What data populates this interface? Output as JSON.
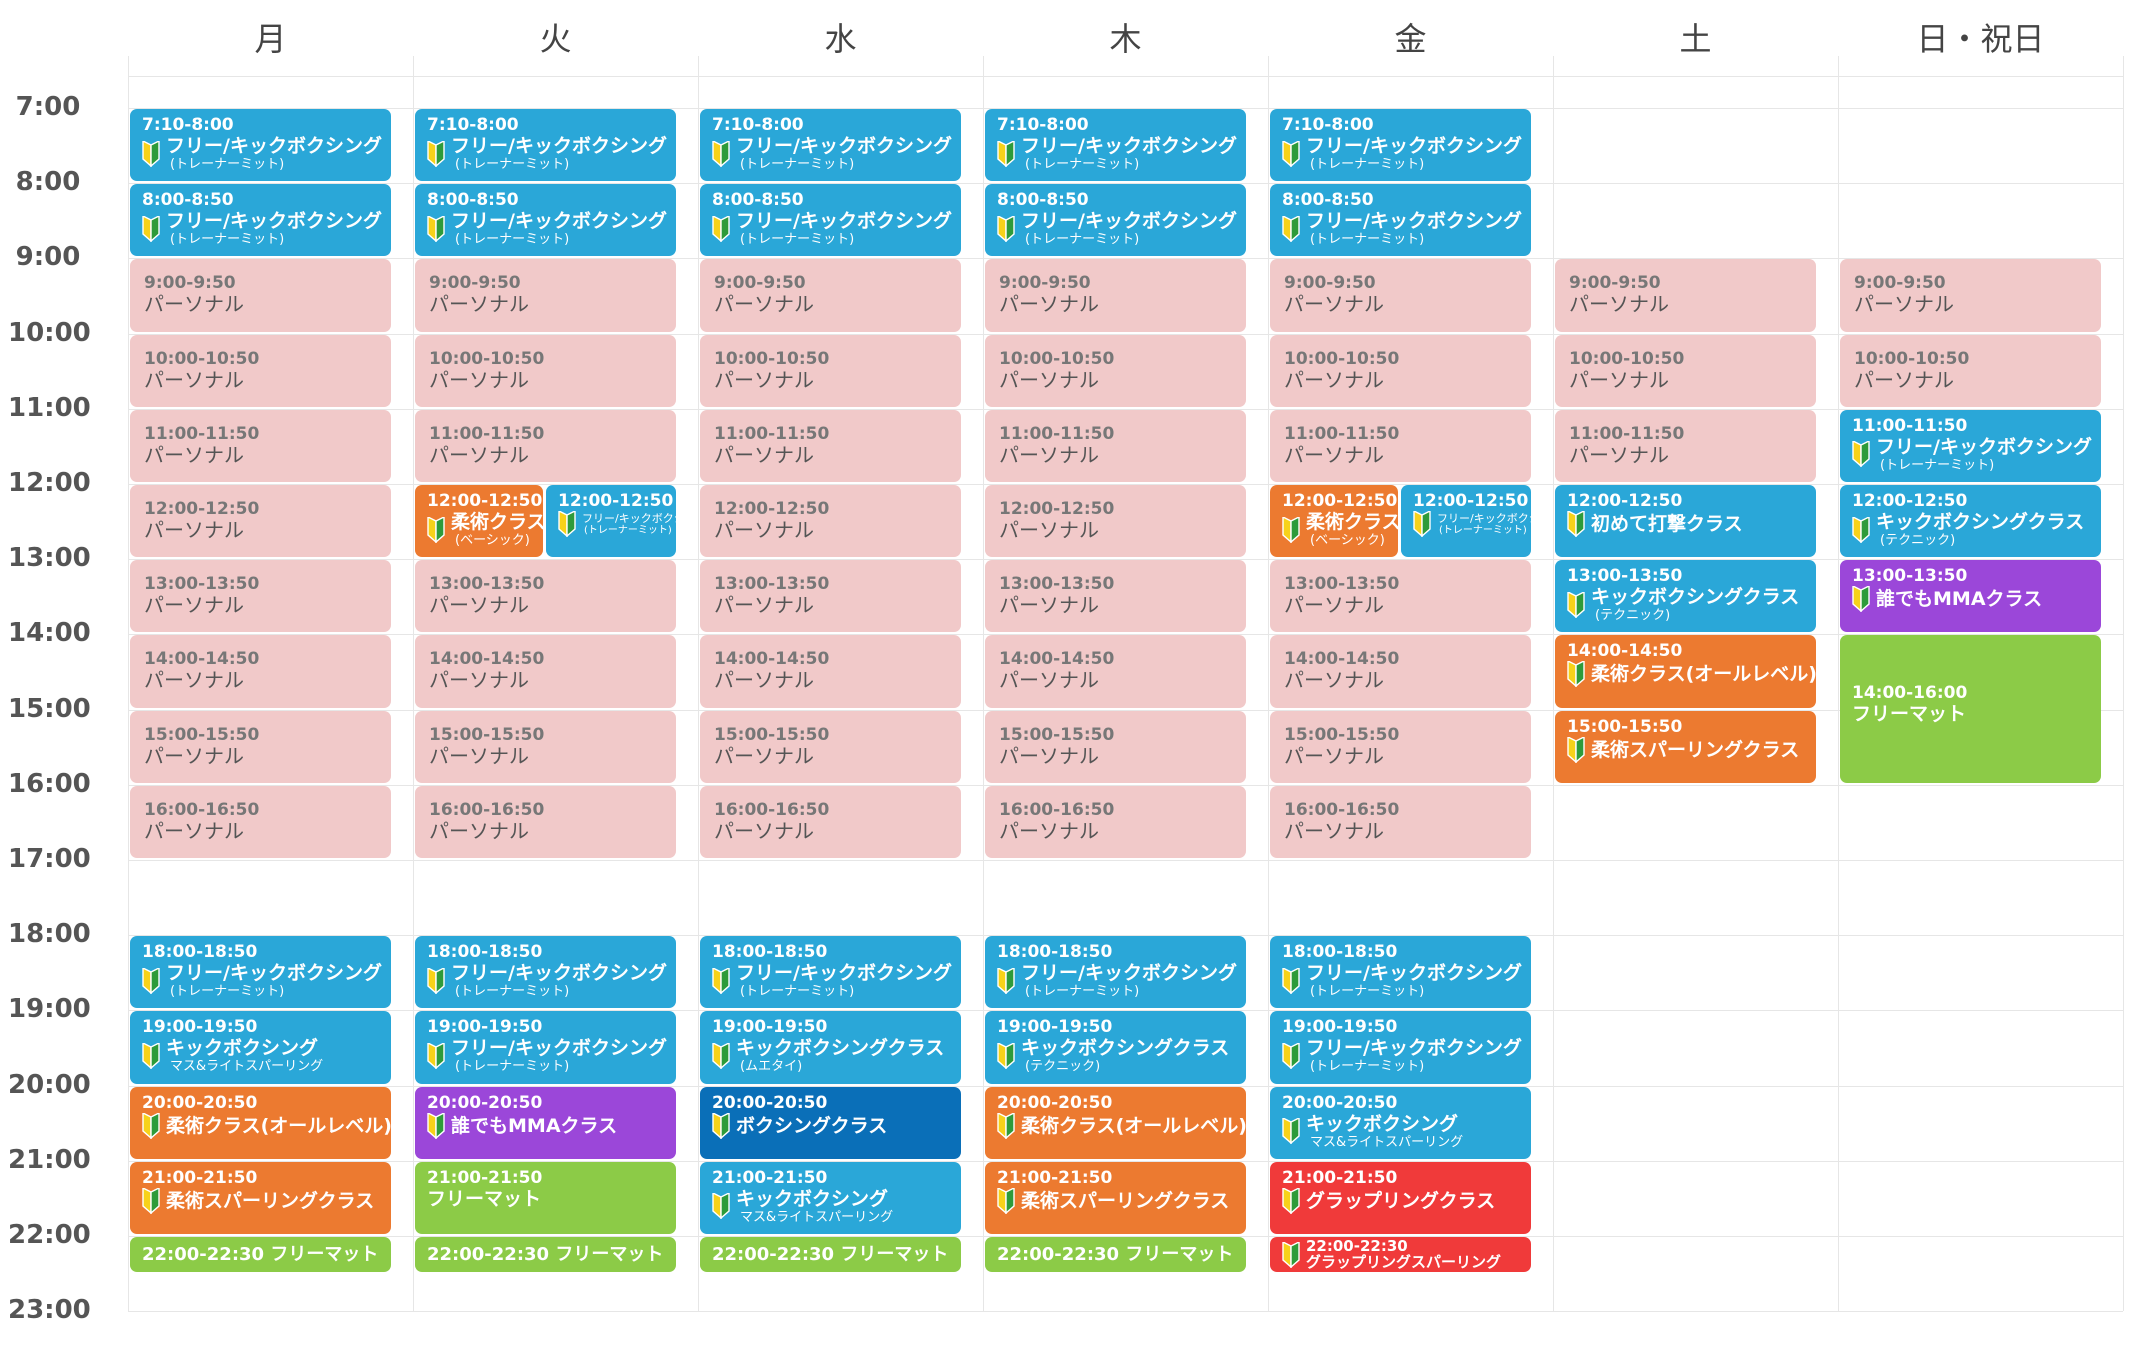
{
  "colors": {
    "personal": "#f1c9c9",
    "kick": "#2aa7d8",
    "jiu": "#ec7a30",
    "mma": "#9b47d9",
    "free": "#8ccb47",
    "boxing": "#0a6fb8",
    "grappling": "#f03a3a"
  },
  "days": [
    "月",
    "火",
    "水",
    "木",
    "金",
    "土",
    "日・祝日"
  ],
  "hours": [
    "7:00",
    "8:00",
    "9:00",
    "10:00",
    "11:00",
    "12:00",
    "13:00",
    "14:00",
    "15:00",
    "16:00",
    "17:00",
    "18:00",
    "19:00",
    "20:00",
    "21:00",
    "22:00",
    "23:00"
  ],
  "events": [
    {
      "d": 0,
      "s": 7.0,
      "e": 8.0,
      "c": "kick",
      "time": "7:10-8:00",
      "title": "フリー/キックボクシング",
      "sub": "(トレーナーミット)",
      "icon": "beginner-icon"
    },
    {
      "d": 0,
      "s": 8.0,
      "e": 9.0,
      "c": "kick",
      "time": "8:00-8:50",
      "title": "フリー/キックボクシング",
      "sub": "(トレーナーミット)",
      "icon": "beginner-icon"
    },
    {
      "d": 0,
      "s": 9.0,
      "e": 10.0,
      "c": "personal",
      "time": "9:00-9:50",
      "title": "パーソナル"
    },
    {
      "d": 0,
      "s": 10.0,
      "e": 11.0,
      "c": "personal",
      "time": "10:00-10:50",
      "title": "パーソナル"
    },
    {
      "d": 0,
      "s": 11.0,
      "e": 12.0,
      "c": "personal",
      "time": "11:00-11:50",
      "title": "パーソナル"
    },
    {
      "d": 0,
      "s": 12.0,
      "e": 13.0,
      "c": "personal",
      "time": "12:00-12:50",
      "title": "パーソナル"
    },
    {
      "d": 0,
      "s": 13.0,
      "e": 14.0,
      "c": "personal",
      "time": "13:00-13:50",
      "title": "パーソナル"
    },
    {
      "d": 0,
      "s": 14.0,
      "e": 15.0,
      "c": "personal",
      "time": "14:00-14:50",
      "title": "パーソナル"
    },
    {
      "d": 0,
      "s": 15.0,
      "e": 16.0,
      "c": "personal",
      "time": "15:00-15:50",
      "title": "パーソナル"
    },
    {
      "d": 0,
      "s": 16.0,
      "e": 17.0,
      "c": "personal",
      "time": "16:00-16:50",
      "title": "パーソナル"
    },
    {
      "d": 0,
      "s": 18.0,
      "e": 19.0,
      "c": "kick",
      "time": "18:00-18:50",
      "title": "フリー/キックボクシング",
      "sub": "(トレーナーミット)",
      "icon": "beginner-icon"
    },
    {
      "d": 0,
      "s": 19.0,
      "e": 20.0,
      "c": "kick",
      "time": "19:00-19:50",
      "title": "キックボクシング",
      "sub": "マス&ライトスパーリング",
      "icon": "beginner-icon"
    },
    {
      "d": 0,
      "s": 20.0,
      "e": 21.0,
      "c": "jiu",
      "time": "20:00-20:50",
      "title": "柔術クラス(オールレベル)",
      "icon": "beginner-icon"
    },
    {
      "d": 0,
      "s": 21.0,
      "e": 22.0,
      "c": "jiu",
      "time": "21:00-21:50",
      "title": "柔術スパーリングクラス",
      "icon": "beginner-icon"
    },
    {
      "d": 0,
      "s": 22.0,
      "e": 22.5,
      "c": "free",
      "inline": "22:00-22:30 フリーマット"
    },
    {
      "d": 1,
      "s": 7.0,
      "e": 8.0,
      "c": "kick",
      "time": "7:10-8:00",
      "title": "フリー/キックボクシング",
      "sub": "(トレーナーミット)",
      "icon": "beginner-icon"
    },
    {
      "d": 1,
      "s": 8.0,
      "e": 9.0,
      "c": "kick",
      "time": "8:00-8:50",
      "title": "フリー/キックボクシング",
      "sub": "(トレーナーミット)",
      "icon": "beginner-icon"
    },
    {
      "d": 1,
      "s": 9.0,
      "e": 10.0,
      "c": "personal",
      "time": "9:00-9:50",
      "title": "パーソナル"
    },
    {
      "d": 1,
      "s": 10.0,
      "e": 11.0,
      "c": "personal",
      "time": "10:00-10:50",
      "title": "パーソナル"
    },
    {
      "d": 1,
      "s": 11.0,
      "e": 12.0,
      "c": "personal",
      "time": "11:00-11:50",
      "title": "パーソナル"
    },
    {
      "d": 1,
      "s": 12.0,
      "e": 13.0,
      "c": "jiu",
      "half": 0,
      "time": "12:00-12:50",
      "title": "柔術クラス",
      "sub": "(ベーシック)",
      "icon": "beginner-icon"
    },
    {
      "d": 1,
      "s": 12.0,
      "e": 13.0,
      "c": "kick",
      "half": 1,
      "time": "12:00-12:50",
      "title": "フリー/キックボクシング",
      "sub": "(トレーナーミット)",
      "icon": "beginner-icon",
      "small": true
    },
    {
      "d": 1,
      "s": 13.0,
      "e": 14.0,
      "c": "personal",
      "time": "13:00-13:50",
      "title": "パーソナル"
    },
    {
      "d": 1,
      "s": 14.0,
      "e": 15.0,
      "c": "personal",
      "time": "14:00-14:50",
      "title": "パーソナル"
    },
    {
      "d": 1,
      "s": 15.0,
      "e": 16.0,
      "c": "personal",
      "time": "15:00-15:50",
      "title": "パーソナル"
    },
    {
      "d": 1,
      "s": 16.0,
      "e": 17.0,
      "c": "personal",
      "time": "16:00-16:50",
      "title": "パーソナル"
    },
    {
      "d": 1,
      "s": 18.0,
      "e": 19.0,
      "c": "kick",
      "time": "18:00-18:50",
      "title": "フリー/キックボクシング",
      "sub": "(トレーナーミット)",
      "icon": "beginner-icon"
    },
    {
      "d": 1,
      "s": 19.0,
      "e": 20.0,
      "c": "kick",
      "time": "19:00-19:50",
      "title": "フリー/キックボクシング",
      "sub": "(トレーナーミット)",
      "icon": "beginner-icon"
    },
    {
      "d": 1,
      "s": 20.0,
      "e": 21.0,
      "c": "mma",
      "time": "20:00-20:50",
      "title": "誰でもMMAクラス",
      "icon": "beginner-icon"
    },
    {
      "d": 1,
      "s": 21.0,
      "e": 22.0,
      "c": "free",
      "time": "21:00-21:50",
      "title": "フリーマット"
    },
    {
      "d": 1,
      "s": 22.0,
      "e": 22.5,
      "c": "free",
      "inline": "22:00-22:30 フリーマット"
    },
    {
      "d": 2,
      "s": 7.0,
      "e": 8.0,
      "c": "kick",
      "time": "7:10-8:00",
      "title": "フリー/キックボクシング",
      "sub": "(トレーナーミット)",
      "icon": "beginner-icon"
    },
    {
      "d": 2,
      "s": 8.0,
      "e": 9.0,
      "c": "kick",
      "time": "8:00-8:50",
      "title": "フリー/キックボクシング",
      "sub": "(トレーナーミット)",
      "icon": "beginner-icon"
    },
    {
      "d": 2,
      "s": 9.0,
      "e": 10.0,
      "c": "personal",
      "time": "9:00-9:50",
      "title": "パーソナル"
    },
    {
      "d": 2,
      "s": 10.0,
      "e": 11.0,
      "c": "personal",
      "time": "10:00-10:50",
      "title": "パーソナル"
    },
    {
      "d": 2,
      "s": 11.0,
      "e": 12.0,
      "c": "personal",
      "time": "11:00-11:50",
      "title": "パーソナル"
    },
    {
      "d": 2,
      "s": 12.0,
      "e": 13.0,
      "c": "personal",
      "time": "12:00-12:50",
      "title": "パーソナル"
    },
    {
      "d": 2,
      "s": 13.0,
      "e": 14.0,
      "c": "personal",
      "time": "13:00-13:50",
      "title": "パーソナル"
    },
    {
      "d": 2,
      "s": 14.0,
      "e": 15.0,
      "c": "personal",
      "time": "14:00-14:50",
      "title": "パーソナル"
    },
    {
      "d": 2,
      "s": 15.0,
      "e": 16.0,
      "c": "personal",
      "time": "15:00-15:50",
      "title": "パーソナル"
    },
    {
      "d": 2,
      "s": 16.0,
      "e": 17.0,
      "c": "personal",
      "time": "16:00-16:50",
      "title": "パーソナル"
    },
    {
      "d": 2,
      "s": 18.0,
      "e": 19.0,
      "c": "kick",
      "time": "18:00-18:50",
      "title": "フリー/キックボクシング",
      "sub": "(トレーナーミット)",
      "icon": "beginner-icon"
    },
    {
      "d": 2,
      "s": 19.0,
      "e": 20.0,
      "c": "kick",
      "time": "19:00-19:50",
      "title": "キックボクシングクラス",
      "sub": "(ムエタイ)",
      "icon": "beginner-icon"
    },
    {
      "d": 2,
      "s": 20.0,
      "e": 21.0,
      "c": "boxing",
      "time": "20:00-20:50",
      "title": "ボクシングクラス",
      "icon": "beginner-icon"
    },
    {
      "d": 2,
      "s": 21.0,
      "e": 22.0,
      "c": "kick",
      "time": "21:00-21:50",
      "title": "キックボクシング",
      "sub": "マス&ライトスパーリング",
      "icon": "beginner-icon"
    },
    {
      "d": 2,
      "s": 22.0,
      "e": 22.5,
      "c": "free",
      "inline": "22:00-22:30 フリーマット"
    },
    {
      "d": 3,
      "s": 7.0,
      "e": 8.0,
      "c": "kick",
      "time": "7:10-8:00",
      "title": "フリー/キックボクシング",
      "sub": "(トレーナーミット)",
      "icon": "beginner-icon"
    },
    {
      "d": 3,
      "s": 8.0,
      "e": 9.0,
      "c": "kick",
      "time": "8:00-8:50",
      "title": "フリー/キックボクシング",
      "sub": "(トレーナーミット)",
      "icon": "beginner-icon"
    },
    {
      "d": 3,
      "s": 9.0,
      "e": 10.0,
      "c": "personal",
      "time": "9:00-9:50",
      "title": "パーソナル"
    },
    {
      "d": 3,
      "s": 10.0,
      "e": 11.0,
      "c": "personal",
      "time": "10:00-10:50",
      "title": "パーソナル"
    },
    {
      "d": 3,
      "s": 11.0,
      "e": 12.0,
      "c": "personal",
      "time": "11:00-11:50",
      "title": "パーソナル"
    },
    {
      "d": 3,
      "s": 12.0,
      "e": 13.0,
      "c": "personal",
      "time": "12:00-12:50",
      "title": "パーソナル"
    },
    {
      "d": 3,
      "s": 13.0,
      "e": 14.0,
      "c": "personal",
      "time": "13:00-13:50",
      "title": "パーソナル"
    },
    {
      "d": 3,
      "s": 14.0,
      "e": 15.0,
      "c": "personal",
      "time": "14:00-14:50",
      "title": "パーソナル"
    },
    {
      "d": 3,
      "s": 15.0,
      "e": 16.0,
      "c": "personal",
      "time": "15:00-15:50",
      "title": "パーソナル"
    },
    {
      "d": 3,
      "s": 16.0,
      "e": 17.0,
      "c": "personal",
      "time": "16:00-16:50",
      "title": "パーソナル"
    },
    {
      "d": 3,
      "s": 18.0,
      "e": 19.0,
      "c": "kick",
      "time": "18:00-18:50",
      "title": "フリー/キックボクシング",
      "sub": "(トレーナーミット)",
      "icon": "beginner-icon"
    },
    {
      "d": 3,
      "s": 19.0,
      "e": 20.0,
      "c": "kick",
      "time": "19:00-19:50",
      "title": "キックボクシングクラス",
      "sub": "(テクニック)",
      "icon": "beginner-icon"
    },
    {
      "d": 3,
      "s": 20.0,
      "e": 21.0,
      "c": "jiu",
      "time": "20:00-20:50",
      "title": "柔術クラス(オールレベル)",
      "icon": "beginner-icon"
    },
    {
      "d": 3,
      "s": 21.0,
      "e": 22.0,
      "c": "jiu",
      "time": "21:00-21:50",
      "title": "柔術スパーリングクラス",
      "icon": "beginner-icon"
    },
    {
      "d": 3,
      "s": 22.0,
      "e": 22.5,
      "c": "free",
      "inline": "22:00-22:30 フリーマット"
    },
    {
      "d": 4,
      "s": 7.0,
      "e": 8.0,
      "c": "kick",
      "time": "7:10-8:00",
      "title": "フリー/キックボクシング",
      "sub": "(トレーナーミット)",
      "icon": "beginner-icon"
    },
    {
      "d": 4,
      "s": 8.0,
      "e": 9.0,
      "c": "kick",
      "time": "8:00-8:50",
      "title": "フリー/キックボクシング",
      "sub": "(トレーナーミット)",
      "icon": "beginner-icon"
    },
    {
      "d": 4,
      "s": 9.0,
      "e": 10.0,
      "c": "personal",
      "time": "9:00-9:50",
      "title": "パーソナル"
    },
    {
      "d": 4,
      "s": 10.0,
      "e": 11.0,
      "c": "personal",
      "time": "10:00-10:50",
      "title": "パーソナル"
    },
    {
      "d": 4,
      "s": 11.0,
      "e": 12.0,
      "c": "personal",
      "time": "11:00-11:50",
      "title": "パーソナル"
    },
    {
      "d": 4,
      "s": 12.0,
      "e": 13.0,
      "c": "jiu",
      "half": 0,
      "time": "12:00-12:50",
      "title": "柔術クラス",
      "sub": "(ベーシック)",
      "icon": "beginner-icon"
    },
    {
      "d": 4,
      "s": 12.0,
      "e": 13.0,
      "c": "kick",
      "half": 1,
      "time": "12:00-12:50",
      "title": "フリー/キックボクシング",
      "sub": "(トレーナーミット)",
      "icon": "beginner-icon",
      "small": true
    },
    {
      "d": 4,
      "s": 13.0,
      "e": 14.0,
      "c": "personal",
      "time": "13:00-13:50",
      "title": "パーソナル"
    },
    {
      "d": 4,
      "s": 14.0,
      "e": 15.0,
      "c": "personal",
      "time": "14:00-14:50",
      "title": "パーソナル"
    },
    {
      "d": 4,
      "s": 15.0,
      "e": 16.0,
      "c": "personal",
      "time": "15:00-15:50",
      "title": "パーソナル"
    },
    {
      "d": 4,
      "s": 16.0,
      "e": 17.0,
      "c": "personal",
      "time": "16:00-16:50",
      "title": "パーソナル"
    },
    {
      "d": 4,
      "s": 18.0,
      "e": 19.0,
      "c": "kick",
      "time": "18:00-18:50",
      "title": "フリー/キックボクシング",
      "sub": "(トレーナーミット)",
      "icon": "beginner-icon"
    },
    {
      "d": 4,
      "s": 19.0,
      "e": 20.0,
      "c": "kick",
      "time": "19:00-19:50",
      "title": "フリー/キックボクシング",
      "sub": "(トレーナーミット)",
      "icon": "beginner-icon"
    },
    {
      "d": 4,
      "s": 20.0,
      "e": 21.0,
      "c": "kick",
      "time": "20:00-20:50",
      "title": "キックボクシング",
      "sub": "マス&ライトスパーリング",
      "icon": "beginner-icon"
    },
    {
      "d": 4,
      "s": 21.0,
      "e": 22.0,
      "c": "grappling",
      "time": "21:00-21:50",
      "title": "グラップリングクラス",
      "icon": "beginner-icon"
    },
    {
      "d": 4,
      "s": 22.0,
      "e": 22.5,
      "c": "grappling",
      "time": "22:00-22:30",
      "title": "グラップリングスパーリング",
      "icon": "beginner-icon",
      "compact": true
    },
    {
      "d": 5,
      "s": 9.0,
      "e": 10.0,
      "c": "personal",
      "time": "9:00-9:50",
      "title": "パーソナル"
    },
    {
      "d": 5,
      "s": 10.0,
      "e": 11.0,
      "c": "personal",
      "time": "10:00-10:50",
      "title": "パーソナル"
    },
    {
      "d": 5,
      "s": 11.0,
      "e": 12.0,
      "c": "personal",
      "time": "11:00-11:50",
      "title": "パーソナル"
    },
    {
      "d": 5,
      "s": 12.0,
      "e": 13.0,
      "c": "kick",
      "time": "12:00-12:50",
      "title": "初めて打撃クラス",
      "icon": "beginner-icon"
    },
    {
      "d": 5,
      "s": 13.0,
      "e": 14.0,
      "c": "kick",
      "time": "13:00-13:50",
      "title": "キックボクシングクラス",
      "sub": "(テクニック)",
      "icon": "beginner-icon"
    },
    {
      "d": 5,
      "s": 14.0,
      "e": 15.0,
      "c": "jiu",
      "time": "14:00-14:50",
      "title": "柔術クラス(オールレベル)",
      "icon": "beginner-icon"
    },
    {
      "d": 5,
      "s": 15.0,
      "e": 16.0,
      "c": "jiu",
      "time": "15:00-15:50",
      "title": "柔術スパーリングクラス",
      "icon": "beginner-icon"
    },
    {
      "d": 6,
      "s": 9.0,
      "e": 10.0,
      "c": "personal",
      "time": "9:00-9:50",
      "title": "パーソナル"
    },
    {
      "d": 6,
      "s": 10.0,
      "e": 11.0,
      "c": "personal",
      "time": "10:00-10:50",
      "title": "パーソナル"
    },
    {
      "d": 6,
      "s": 11.0,
      "e": 12.0,
      "c": "kick",
      "time": "11:00-11:50",
      "title": "フリー/キックボクシング",
      "sub": "(トレーナーミット)",
      "icon": "beginner-icon"
    },
    {
      "d": 6,
      "s": 12.0,
      "e": 13.0,
      "c": "kick",
      "time": "12:00-12:50",
      "title": "キックボクシングクラス",
      "sub": "(テクニック)",
      "icon": "beginner-icon"
    },
    {
      "d": 6,
      "s": 13.0,
      "e": 14.0,
      "c": "mma",
      "time": "13:00-13:50",
      "title": "誰でもMMAクラス",
      "icon": "beginner-icon"
    },
    {
      "d": 6,
      "s": 14.0,
      "e": 16.0,
      "c": "free",
      "time": "14:00-16:00",
      "title": "フリーマット",
      "tall": true
    }
  ]
}
